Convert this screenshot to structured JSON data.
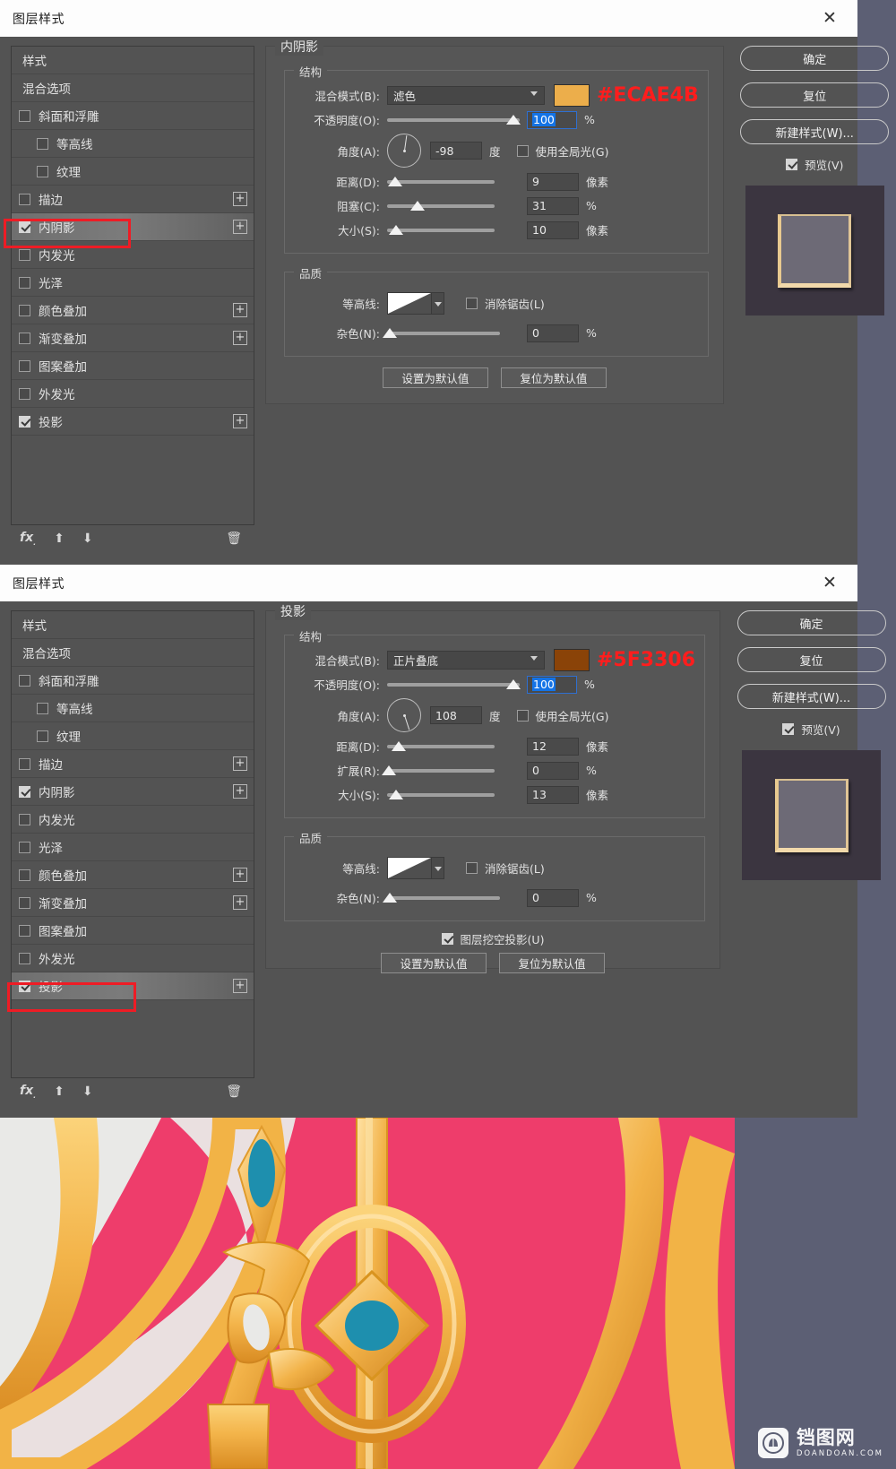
{
  "dialog1": {
    "title": "图层样式",
    "close_label": "✕",
    "styles_panel": {
      "rows": [
        {
          "label": "样式",
          "checkbox": null,
          "plus": false,
          "indent": false,
          "selected": false
        },
        {
          "label": "混合选项",
          "checkbox": null,
          "plus": false,
          "indent": false,
          "selected": false
        },
        {
          "label": "斜面和浮雕",
          "checkbox": false,
          "plus": false,
          "indent": false,
          "selected": false
        },
        {
          "label": "等高线",
          "checkbox": false,
          "plus": false,
          "indent": true,
          "selected": false
        },
        {
          "label": "纹理",
          "checkbox": false,
          "plus": false,
          "indent": true,
          "selected": false
        },
        {
          "label": "描边",
          "checkbox": false,
          "plus": true,
          "indent": false,
          "selected": false
        },
        {
          "label": "内阴影",
          "checkbox": true,
          "plus": true,
          "indent": false,
          "selected": true
        },
        {
          "label": "内发光",
          "checkbox": false,
          "plus": false,
          "indent": false,
          "selected": false
        },
        {
          "label": "光泽",
          "checkbox": false,
          "plus": false,
          "indent": false,
          "selected": false
        },
        {
          "label": "颜色叠加",
          "checkbox": false,
          "plus": true,
          "indent": false,
          "selected": false
        },
        {
          "label": "渐变叠加",
          "checkbox": false,
          "plus": true,
          "indent": false,
          "selected": false
        },
        {
          "label": "图案叠加",
          "checkbox": false,
          "plus": false,
          "indent": false,
          "selected": false
        },
        {
          "label": "外发光",
          "checkbox": false,
          "plus": false,
          "indent": false,
          "selected": false
        },
        {
          "label": "投影",
          "checkbox": true,
          "plus": true,
          "indent": false,
          "selected": false
        }
      ],
      "footer_icons": [
        "fx-icon",
        "up-arrow-icon",
        "down-arrow-icon",
        "trash-icon"
      ]
    },
    "settings": {
      "panel_title": "内阴影",
      "structure_title": "结构",
      "blend_mode_label": "混合模式(B):",
      "blend_mode_value": "滤色",
      "color_swatch": "#ECAE4B",
      "color_note": "#ECAE4B",
      "opacity_label": "不透明度(O):",
      "opacity_value": "100",
      "opacity_unit": "%",
      "opacity_pct": 100,
      "angle_label": "角度(A):",
      "angle_value": "-98",
      "angle_unit": "度",
      "global_light_label": "使用全局光(G)",
      "global_light_checked": false,
      "distance_label": "距离(D):",
      "distance_value": "9",
      "distance_unit": "像素",
      "distance_pct": 4,
      "choke_label": "阻塞(C):",
      "choke_value": "31",
      "choke_unit": "%",
      "choke_pct": 24,
      "size_label": "大小(S):",
      "size_value": "10",
      "size_unit": "像素",
      "size_pct": 5,
      "quality_title": "品质",
      "contour_label": "等高线:",
      "antialias_label": "消除锯齿(L)",
      "antialias_checked": false,
      "noise_label": "杂色(N):",
      "noise_value": "0",
      "noise_unit": "%",
      "noise_pct": 0,
      "set_default_label": "设置为默认值",
      "reset_default_label": "复位为默认值"
    },
    "buttons": {
      "ok": "确定",
      "reset": "复位",
      "new_style": "新建样式(W)...",
      "preview_label": "预览(V)",
      "preview_checked": true
    }
  },
  "dialog2": {
    "title": "图层样式",
    "close_label": "✕",
    "styles_panel": {
      "rows": [
        {
          "label": "样式",
          "checkbox": null,
          "plus": false,
          "indent": false,
          "selected": false
        },
        {
          "label": "混合选项",
          "checkbox": null,
          "plus": false,
          "indent": false,
          "selected": false
        },
        {
          "label": "斜面和浮雕",
          "checkbox": false,
          "plus": false,
          "indent": false,
          "selected": false
        },
        {
          "label": "等高线",
          "checkbox": false,
          "plus": false,
          "indent": true,
          "selected": false
        },
        {
          "label": "纹理",
          "checkbox": false,
          "plus": false,
          "indent": true,
          "selected": false
        },
        {
          "label": "描边",
          "checkbox": false,
          "plus": true,
          "indent": false,
          "selected": false
        },
        {
          "label": "内阴影",
          "checkbox": true,
          "plus": true,
          "indent": false,
          "selected": false
        },
        {
          "label": "内发光",
          "checkbox": false,
          "plus": false,
          "indent": false,
          "selected": false
        },
        {
          "label": "光泽",
          "checkbox": false,
          "plus": false,
          "indent": false,
          "selected": false
        },
        {
          "label": "颜色叠加",
          "checkbox": false,
          "plus": true,
          "indent": false,
          "selected": false
        },
        {
          "label": "渐变叠加",
          "checkbox": false,
          "plus": true,
          "indent": false,
          "selected": false
        },
        {
          "label": "图案叠加",
          "checkbox": false,
          "plus": false,
          "indent": false,
          "selected": false
        },
        {
          "label": "外发光",
          "checkbox": false,
          "plus": false,
          "indent": false,
          "selected": false
        },
        {
          "label": "投影",
          "checkbox": true,
          "plus": true,
          "indent": false,
          "selected": true
        }
      ],
      "footer_icons": [
        "fx-icon",
        "up-arrow-icon",
        "down-arrow-icon",
        "trash-icon"
      ]
    },
    "settings": {
      "panel_title": "投影",
      "structure_title": "结构",
      "blend_mode_label": "混合模式(B):",
      "blend_mode_value": "正片叠底",
      "color_swatch": "#5F3306",
      "color_note": "#5F3306",
      "opacity_label": "不透明度(O):",
      "opacity_value": "100",
      "opacity_unit": "%",
      "opacity_pct": 100,
      "angle_label": "角度(A):",
      "angle_value": "108",
      "angle_unit": "度",
      "global_light_label": "使用全局光(G)",
      "global_light_checked": false,
      "distance_label": "距离(D):",
      "distance_value": "12",
      "distance_unit": "像素",
      "distance_pct": 6,
      "spread_label": "扩展(R):",
      "spread_value": "0",
      "spread_unit": "%",
      "spread_pct": 0,
      "size_label": "大小(S):",
      "size_value": "13",
      "size_unit": "像素",
      "size_pct": 6,
      "quality_title": "品质",
      "contour_label": "等高线:",
      "antialias_label": "消除锯齿(L)",
      "antialias_checked": false,
      "noise_label": "杂色(N):",
      "noise_value": "0",
      "noise_unit": "%",
      "noise_pct": 0,
      "knockout_label": "图层挖空投影(U)",
      "knockout_checked": true,
      "set_default_label": "设置为默认值",
      "reset_default_label": "复位为默认值"
    },
    "buttons": {
      "ok": "确定",
      "reset": "复位",
      "new_style": "新建样式(W)...",
      "preview_label": "预览(V)",
      "preview_checked": true
    }
  },
  "artwork": {
    "description": "golden-chinese-character-artwork",
    "bg_color": "#E8E8E6",
    "accent_pink": "#EE3D6B",
    "gold": "#F0B544",
    "teal": "#1E8FAE",
    "watermark_cn": "铛图网",
    "watermark_en": "DOANDOAN.COM"
  }
}
